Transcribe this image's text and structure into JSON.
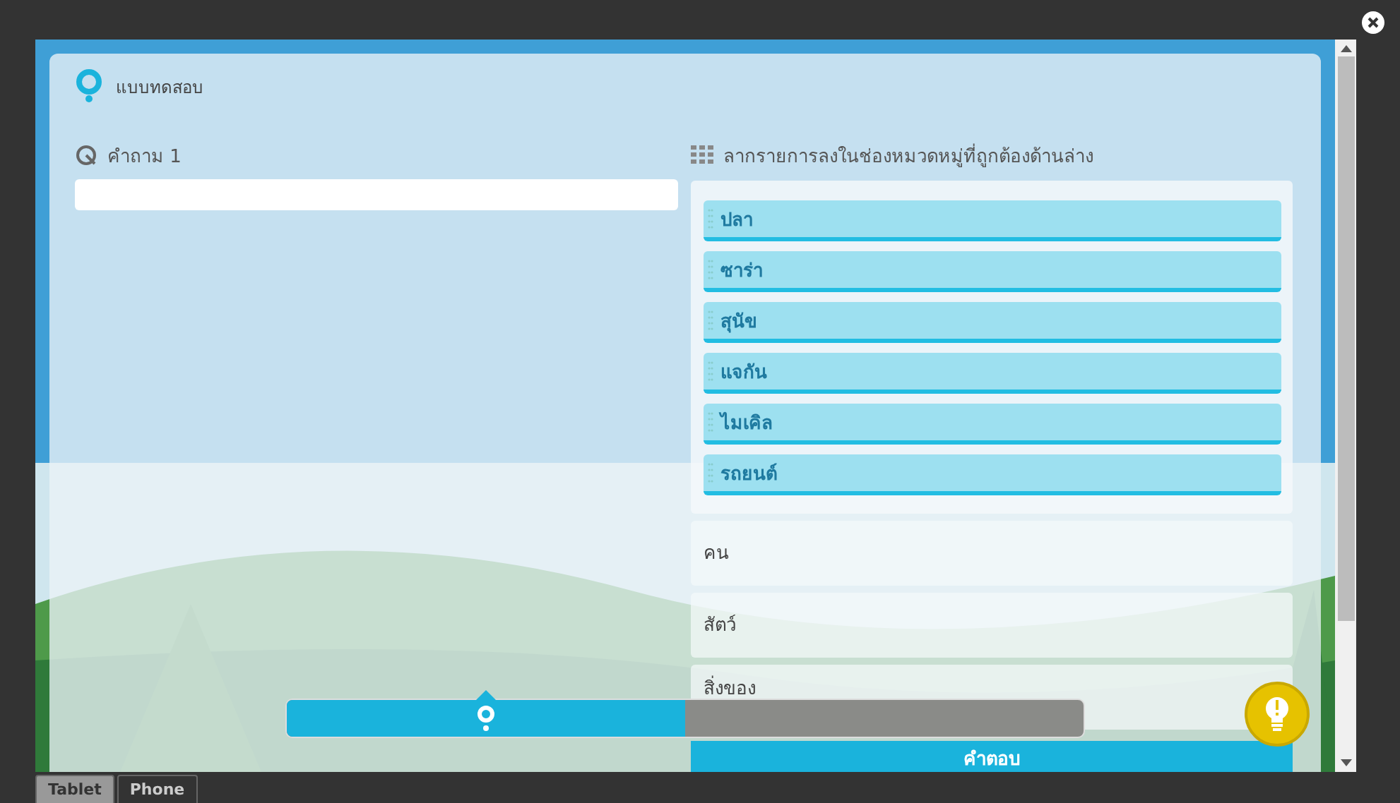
{
  "header": {
    "title": "แบบทดสอบ"
  },
  "question": {
    "label": "คำถาม 1"
  },
  "instruction": "ลากรายการลงในช่องหมวดหมู่ที่ถูกต้องด้านล่าง",
  "items": [
    {
      "label": "ปลา"
    },
    {
      "label": "ซาร่า"
    },
    {
      "label": "สุนัข"
    },
    {
      "label": "แจกัน"
    },
    {
      "label": "ไมเคิล"
    },
    {
      "label": "รถยนต์"
    }
  ],
  "categories": [
    {
      "label": "คน"
    },
    {
      "label": "สัตว์"
    },
    {
      "label": "สิ่งของ"
    }
  ],
  "answer_button": "คำตอบ",
  "progress": {
    "level": 0.5
  },
  "device_tabs": [
    {
      "label": "Tablet",
      "selected": true
    },
    {
      "label": "Phone",
      "selected": false
    }
  ]
}
